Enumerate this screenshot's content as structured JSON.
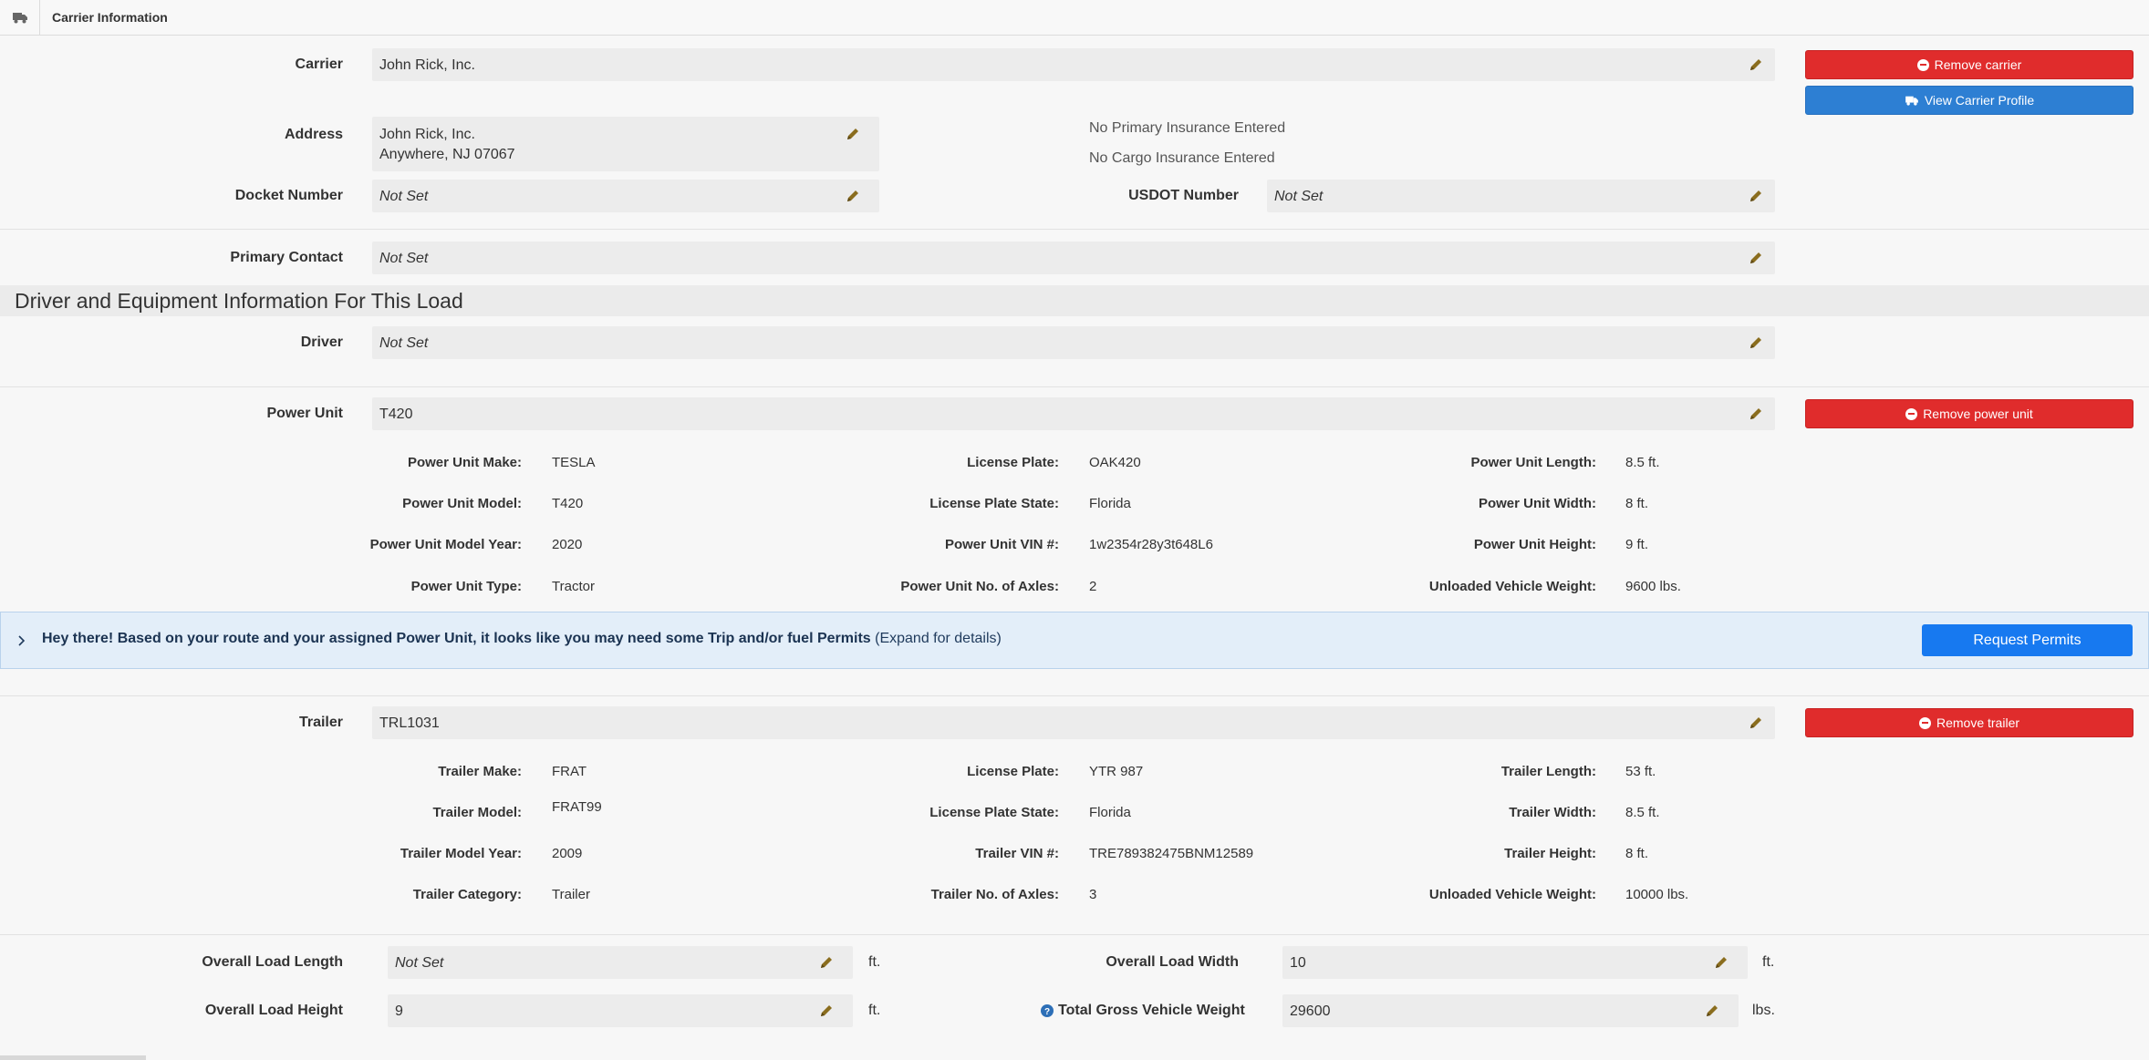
{
  "header": {
    "title": "Carrier Information",
    "icon": "truck-icon"
  },
  "carrier": {
    "label": "Carrier",
    "value": "John Rick, Inc.",
    "remove_label": "Remove carrier",
    "view_profile_label": "View Carrier Profile"
  },
  "address": {
    "label": "Address",
    "line1": "John Rick, Inc.",
    "line2": "Anywhere, NJ 07067"
  },
  "insurance": {
    "primary": "No Primary Insurance Entered",
    "cargo": "No Cargo Insurance Entered"
  },
  "docket": {
    "label": "Docket Number",
    "value": "Not Set"
  },
  "usdot": {
    "label": "USDOT Number",
    "value": "Not Set"
  },
  "primary_contact": {
    "label": "Primary Contact",
    "value": "Not Set"
  },
  "section_title": "Driver and Equipment Information For This Load",
  "driver": {
    "label": "Driver",
    "value": "Not Set"
  },
  "power_unit": {
    "label": "Power Unit",
    "value": "T420",
    "remove_label": "Remove power unit",
    "details": [
      [
        {
          "l": "Power Unit Make:",
          "v": "TESLA"
        },
        {
          "l": "License Plate:",
          "v": "OAK420"
        },
        {
          "l": "Power Unit Length:",
          "v": "8.5 ft."
        }
      ],
      [
        {
          "l": "Power Unit Model:",
          "v": "T420"
        },
        {
          "l": "License Plate State:",
          "v": "Florida"
        },
        {
          "l": "Power Unit Width:",
          "v": "8 ft."
        }
      ],
      [
        {
          "l": "Power Unit Model Year:",
          "v": "2020"
        },
        {
          "l": "Power Unit VIN #:",
          "v": "1w2354r28y3t648L6"
        },
        {
          "l": "Power Unit Height:",
          "v": "9 ft."
        }
      ],
      [
        {
          "l": "Power Unit Type:",
          "v": "Tractor"
        },
        {
          "l": "Power Unit No. of Axles:",
          "v": "2"
        },
        {
          "l": "Unloaded Vehicle Weight:",
          "v": "9600 lbs."
        }
      ]
    ]
  },
  "notice": {
    "bold": "Hey there! Based on your route and your assigned Power Unit, it looks like you may need some Trip and/or fuel Permits",
    "expand": "(Expand for details)",
    "button": "Request Permits"
  },
  "trailer": {
    "label": "Trailer",
    "value": "TRL1031",
    "remove_label": "Remove trailer",
    "details": [
      [
        {
          "l": "Trailer Make:",
          "v": "FRAT"
        },
        {
          "l": "License Plate:",
          "v": "YTR 987"
        },
        {
          "l": "Trailer Length:",
          "v": "53 ft."
        }
      ],
      [
        {
          "l": "Trailer Model:",
          "v": "FRAT99"
        },
        {
          "l": "License Plate State:",
          "v": "Florida"
        },
        {
          "l": "Trailer Width:",
          "v": "8.5 ft."
        }
      ],
      [
        {
          "l": "Trailer Model Year:",
          "v": "2009"
        },
        {
          "l": "Trailer VIN #:",
          "v": "TRE789382475BNM12589"
        },
        {
          "l": "Trailer Height:",
          "v": "8 ft."
        }
      ],
      [
        {
          "l": "Trailer Category:",
          "v": "Trailer"
        },
        {
          "l": "Trailer No. of Axles:",
          "v": "3"
        },
        {
          "l": "Unloaded Vehicle Weight:",
          "v": "10000 lbs."
        }
      ]
    ]
  },
  "overall": {
    "length": {
      "label": "Overall Load Length",
      "value": "Not Set",
      "unit": "ft."
    },
    "width": {
      "label": "Overall Load Width",
      "value": "10",
      "unit": "ft."
    },
    "height": {
      "label": "Overall Load Height",
      "value": "9",
      "unit": "ft."
    },
    "gvw": {
      "label": "Total Gross Vehicle Weight",
      "value": "29600",
      "unit": "lbs."
    }
  },
  "colors": {
    "danger": "#e02c2c",
    "info": "#2d7fd3",
    "primary": "#1779f0",
    "notice_bg": "#e3eef9",
    "pencil": "#8a6d1e"
  }
}
